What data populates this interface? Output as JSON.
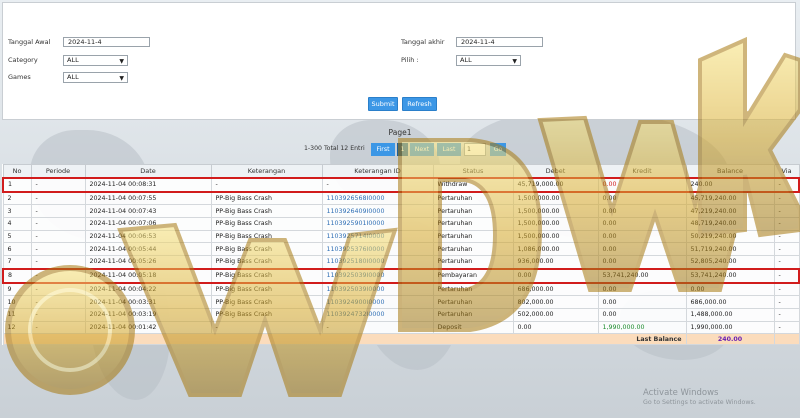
{
  "filters": {
    "start_date": {
      "label": "Tanggal Awal",
      "value": "2024-11-4"
    },
    "end_date": {
      "label": "Tanggal akhir",
      "value": "2024-11-4"
    },
    "category": {
      "label": "Category",
      "value": "ALL"
    },
    "games": {
      "label": "Games",
      "value": "ALL"
    },
    "pilih": {
      "label": "Pilih :",
      "value": "ALL"
    },
    "submit_label": "Submit",
    "refresh_label": "Refresh"
  },
  "page_title": "Page1",
  "pagination": {
    "info": "1-300 Total 12 Entri",
    "first": "First",
    "current": "1",
    "next": "Next",
    "last": "Last",
    "page_input": "1",
    "go": "Go"
  },
  "table": {
    "headers": [
      "No",
      "Periode",
      "Date",
      "Keterangan",
      "Keterangan ID",
      "Status",
      "Debet",
      "Kredit",
      "Balance",
      "Via"
    ],
    "rows": [
      {
        "no": "1",
        "periode": "-",
        "date": "2024-11-04 00:08:31",
        "keterangan": "-",
        "ket_id": "-",
        "status": "Withdraw",
        "debet": "45,719,000.00",
        "kredit": "0.00",
        "balance": "240.00",
        "via": "-"
      },
      {
        "no": "2",
        "periode": "-",
        "date": "2024-11-04 00:07:55",
        "keterangan": "PP-Big Bass Crash",
        "ket_id": "1103926568I0000",
        "status": "Pertaruhan",
        "debet": "1,500,000.00",
        "kredit": "0.00",
        "balance": "45,719,240.00",
        "via": "-"
      },
      {
        "no": "3",
        "periode": "-",
        "date": "2024-11-04 00:07:43",
        "keterangan": "PP-Big Bass Crash",
        "ket_id": "1103926409I0000",
        "status": "Pertaruhan",
        "debet": "1,500,000.00",
        "kredit": "0.00",
        "balance": "47,219,240.00",
        "via": "-"
      },
      {
        "no": "4",
        "periode": "-",
        "date": "2024-11-04 00:07:06",
        "keterangan": "PP-Big Bass Crash",
        "ket_id": "1103925901I0000",
        "status": "Pertaruhan",
        "debet": "1,500,000.00",
        "kredit": "0.00",
        "balance": "48,719,240.00",
        "via": "-"
      },
      {
        "no": "5",
        "periode": "-",
        "date": "2024-11-04 00:06:53",
        "keterangan": "PP-Big Bass Crash",
        "ket_id": "1103925714I0000",
        "status": "Pertaruhan",
        "debet": "1,500,000.00",
        "kredit": "0.00",
        "balance": "50,219,240.00",
        "via": "-"
      },
      {
        "no": "6",
        "periode": "-",
        "date": "2024-11-04 00:05:44",
        "keterangan": "PP-Big Bass Crash",
        "ket_id": "1103925376I0000",
        "status": "Pertaruhan",
        "debet": "1,086,000.00",
        "kredit": "0.00",
        "balance": "51,719,240.00",
        "via": "-"
      },
      {
        "no": "7",
        "periode": "-",
        "date": "2024-11-04 00:05:26",
        "keterangan": "PP-Big Bass Crash",
        "ket_id": "1103925180I0000",
        "status": "Pertaruhan",
        "debet": "936,000.00",
        "kredit": "0.00",
        "balance": "52,805,240.00",
        "via": "-"
      },
      {
        "no": "8",
        "periode": "-",
        "date": "2024-11-04 00:05:18",
        "keterangan": "PP-Big Bass Crash",
        "ket_id": "1103925039I0000",
        "status": "Pembayaran",
        "debet": "0.00",
        "kredit": "53,741,240.00",
        "balance": "53,741,240.00",
        "via": "-"
      },
      {
        "no": "9",
        "periode": "-",
        "date": "2024-11-04 00:04:22",
        "keterangan": "PP-Big Bass Crash",
        "ket_id": "1103925039I0000",
        "status": "Pertaruhan",
        "debet": "686,000.00",
        "kredit": "0.00",
        "balance": "0.00",
        "via": "-"
      },
      {
        "no": "10",
        "periode": "-",
        "date": "2024-11-04 00:03:31",
        "keterangan": "PP-Big Bass Crash",
        "ket_id": "1103924900I0000",
        "status": "Pertaruhan",
        "debet": "802,000.00",
        "kredit": "0.00",
        "balance": "686,000.00",
        "via": "-"
      },
      {
        "no": "11",
        "periode": "-",
        "date": "2024-11-04 00:03:19",
        "keterangan": "PP-Big Bass Crash",
        "ket_id": "1103924732I0000",
        "status": "Pertaruhan",
        "debet": "502,000.00",
        "kredit": "0.00",
        "balance": "1,488,000.00",
        "via": "-"
      },
      {
        "no": "12",
        "periode": "-",
        "date": "2024-11-04 00:01:42",
        "keterangan": "-",
        "ket_id": "-",
        "status": "Deposit",
        "debet": "0.00",
        "kredit": "1,990,000.00",
        "balance": "1,990,000.00",
        "via": "-"
      }
    ],
    "last_balance_label": "Last Balance",
    "last_balance_value": "240.00"
  },
  "watermark_text": "WDWK",
  "os_notice": {
    "title": "Activate Windows",
    "subtitle": "Go to Settings to activate Windows."
  },
  "colors": {
    "accent": "#3c97e6",
    "highlight": "#d11c1c",
    "credit_green": "#1a8a2a",
    "footer_bg": "#fbdcbc"
  }
}
